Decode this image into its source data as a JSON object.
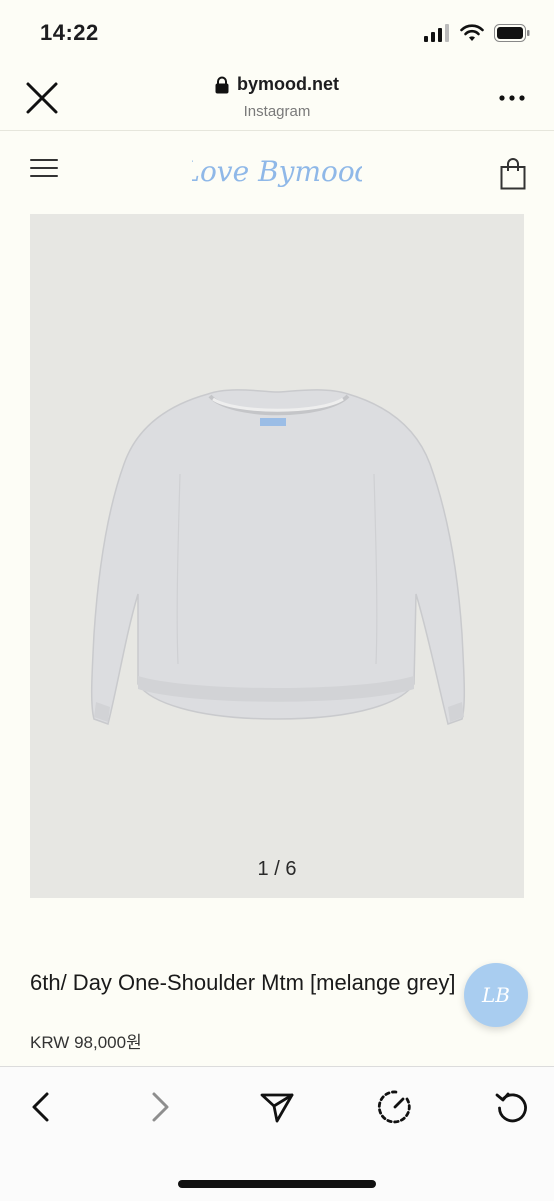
{
  "status_bar": {
    "time": "14:22",
    "icons": [
      "signal-icon",
      "wifi-icon",
      "battery-icon"
    ]
  },
  "browser": {
    "domain": "bymood.net",
    "source": "Instagram",
    "icons": [
      "close-icon",
      "lock-icon",
      "more-icon"
    ]
  },
  "site": {
    "logo_text": "Love Bymood",
    "icons": [
      "hamburger-menu-icon",
      "shopping-bag-icon"
    ]
  },
  "product": {
    "image_counter": "1 / 6",
    "title": "6th/ Day One-Shoulder Mtm [melange grey]",
    "price": "KRW 98,000원"
  },
  "chat_badge": {
    "text": "LB"
  },
  "toolbar": {
    "icons": [
      "back-icon",
      "forward-icon",
      "share-icon",
      "compass-icon",
      "reload-icon"
    ]
  },
  "colors": {
    "page_bg": "#fdfdf6",
    "logo_blue": "#8fb8e8",
    "badge_blue": "#a9cdf0",
    "image_bg": "#e7e7e3"
  }
}
